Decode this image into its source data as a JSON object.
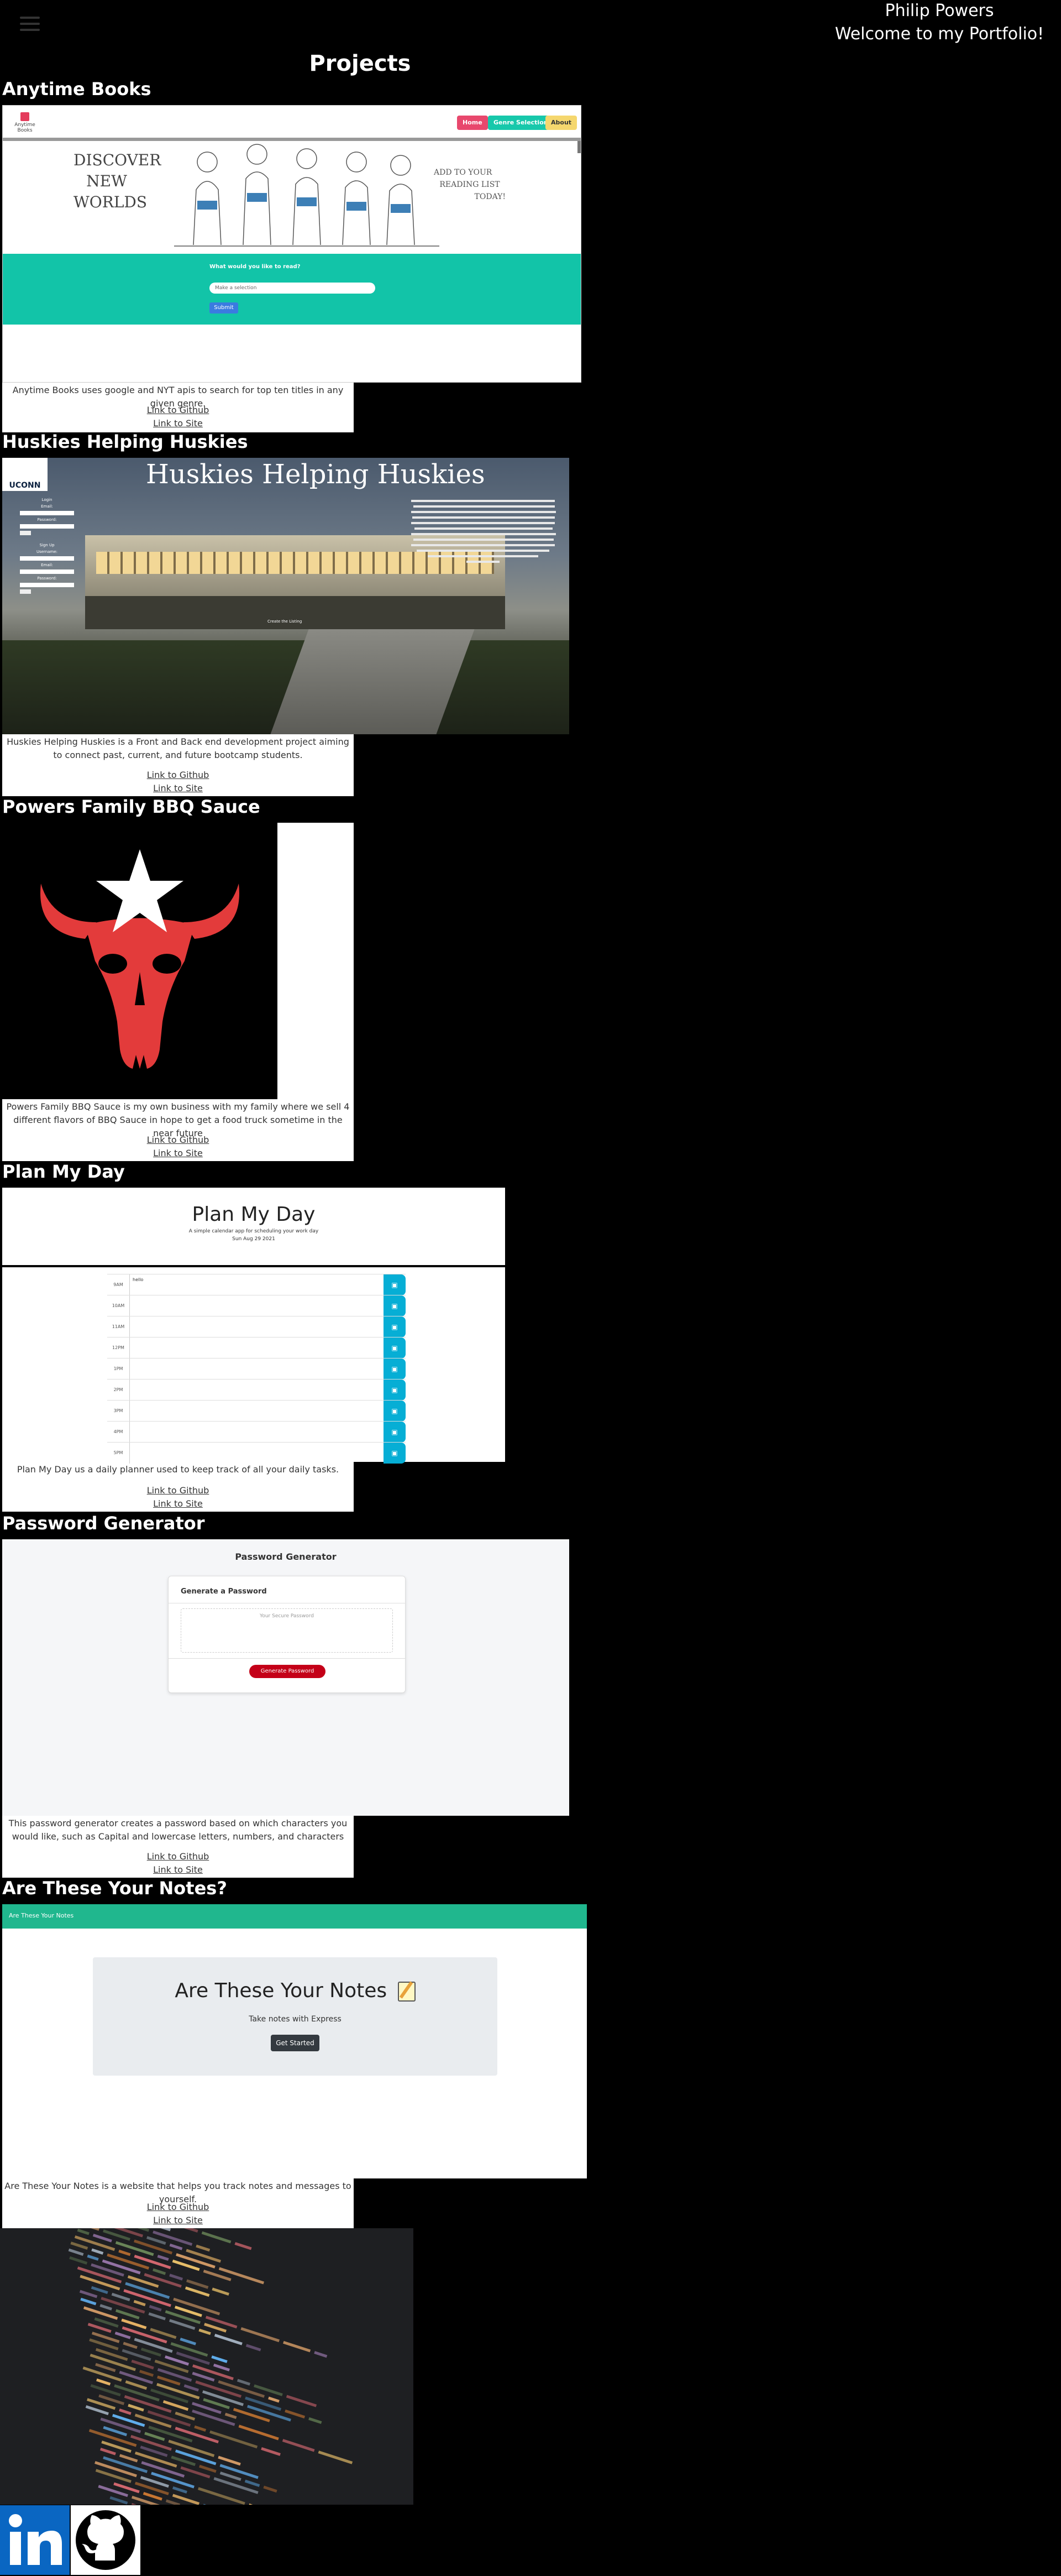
{
  "header": {
    "name": "Philip Powers",
    "welcome": "Welcome to my Portfolio!"
  },
  "projects_heading": "Projects",
  "projects": [
    {
      "title": "Anytime Books",
      "description": "Anytime Books uses google and NYT apis to search for top ten titles in any given genre.",
      "github_label": "Link to Github",
      "site_label": "Link to Site",
      "preview": {
        "logo": "Anytime Books",
        "nav": [
          "Home",
          "Genre Selection",
          "About"
        ],
        "hero_left": [
          "DISCOVER",
          "NEW",
          "WORLDS"
        ],
        "hero_right": [
          "ADD TO YOUR",
          "READING LIST",
          "TODAY!"
        ],
        "question": "What would you like to read?",
        "select_placeholder": "Make a selection",
        "submit": "Submit"
      }
    },
    {
      "title": "Huskies Helping Huskies",
      "description": "Huskies Helping Huskies is a Front and Back end development project aiming to connect past, current, and future bootcamp students.",
      "github_label": "Link to Github",
      "site_label": "Link to Site",
      "preview": {
        "banner": "Huskies Helping Huskies",
        "logo": "UCONN",
        "login_label": "Login",
        "email_label": "Email:",
        "password_label": "Password:",
        "signup_label": "Sign Up",
        "username_label": "Username:",
        "caption": "Create the Listing"
      }
    },
    {
      "title": "Powers Family BBQ Sauce",
      "description": "Powers Family BBQ Sauce is my own business with my family where we sell 4 different flavors of BBQ Sauce in hope to get a food truck sometime in the near future",
      "github_label": "Link to Github",
      "site_label": "Link to Site"
    },
    {
      "title": "Plan My Day",
      "description": "Plan My Day us a daily planner used to keep track of all your daily tasks.",
      "github_label": "Link to Github",
      "site_label": "Link to Site",
      "preview": {
        "heading": "Plan My Day",
        "subtitle": "A simple calendar app for scheduling your work day",
        "date": "Sun Aug 29 2021",
        "first_entry": "hello",
        "hours": [
          "9AM",
          "10AM",
          "11AM",
          "12PM",
          "1PM",
          "2PM",
          "3PM",
          "4PM",
          "5PM"
        ],
        "save_icon": "floppy-disk-icon"
      }
    },
    {
      "title": "Password Generator",
      "description": "This password generator creates a password based on which characters you would like, such as Capital and lowercase letters, numbers, and characters",
      "github_label": "Link to Github",
      "site_label": "Link to Site",
      "preview": {
        "heading": "Password Generator",
        "card_title": "Generate a Password",
        "placeholder": "Your Secure Password",
        "button": "Generate Password"
      }
    },
    {
      "title": "Are These Your Notes?",
      "description": "Are These Your Notes is a website that helps you track notes and messages to yourself.",
      "github_label": "Link to Github",
      "site_label": "Link to Site",
      "preview": {
        "navbar": "Are These Your Notes",
        "heading": "Are These Your Notes",
        "subtitle": "Take notes with Express",
        "button": "Get Started"
      }
    }
  ],
  "footer_icons": [
    "linkedin-icon",
    "github-icon"
  ],
  "colors": {
    "background": "#000000",
    "card": "#ffffff",
    "teal": "#12c4a8",
    "pmd_blue": "#06aed5",
    "pw_red": "#c40018",
    "notes_green": "#20b78e",
    "linkedin_blue": "#0a66c2"
  }
}
